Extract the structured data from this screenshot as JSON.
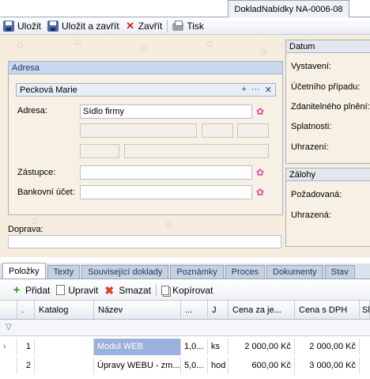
{
  "document_tab": {
    "title": "DokladNabídky NA-0006-08"
  },
  "toolbar": {
    "save_label": "Uložit",
    "save_close_label": "Uložit a zavřít",
    "close_label": "Zavřít",
    "print_label": "Tisk"
  },
  "adresa": {
    "panel_title": "Adresa",
    "partner_name": "Pecková Marie",
    "partner_actions": {
      "add": "+",
      "more": "···",
      "remove": "✕"
    },
    "address_label": "Adresa:",
    "address_value": "Sídlo firmy",
    "representative_label": "Zástupce:",
    "bank_account_label": "Bankovní účet:"
  },
  "doprava": {
    "label": "Doprava:"
  },
  "datum": {
    "panel_title": "Datum",
    "issued_label": "Vystavení:",
    "accounting_label": "Účetního případu:",
    "taxable_label": "Zdanitelného plnění:",
    "due_label": "Splatnosti:",
    "paid_label": "Uhrazení:"
  },
  "zalohy": {
    "panel_title": "Zálohy",
    "required_label": "Požadovaná:",
    "paid_label": "Uhrazená:"
  },
  "tabs": [
    "Položky",
    "Texty",
    "Související doklady",
    "Poznámky",
    "Proces",
    "Dokumenty",
    "Stav"
  ],
  "active_tab": "Položky",
  "items_toolbar": {
    "add_label": "Přidat",
    "edit_label": "Upravit",
    "delete_label": "Smazat",
    "copy_label": "Kopírovat"
  },
  "grid": {
    "columns": [
      ".",
      "Katalog",
      "Název",
      "...",
      "J",
      "Cena za je...",
      "Cena s DPH",
      "Sl"
    ],
    "rows": [
      {
        "no": "1",
        "catalog": "",
        "name": "Modul WEB",
        "qty": "1,0...",
        "unit": "ks",
        "unit_price": "2 000,00 Kč",
        "price_vat": "2 000,00 Kč"
      },
      {
        "no": "2",
        "catalog": "",
        "name": "Úpravy WEBU - zm...",
        "qty": "5,0...",
        "unit": "hod",
        "unit_price": "600,00 Kč",
        "price_vat": "3 000,00 Kč"
      }
    ]
  },
  "colors": {
    "form_bg": "#f5ecdd",
    "panel_header": "#c9d8ee",
    "selection": "#9ab0dd",
    "accent_pink": "#d64d9e"
  },
  "icons": [
    "save-icon",
    "save-close-icon",
    "close-icon",
    "print-icon",
    "add-icon",
    "edit-icon",
    "delete-icon",
    "copy-icon",
    "filter-icon",
    "row-pointer-icon",
    "butterfly-picker-icon"
  ]
}
